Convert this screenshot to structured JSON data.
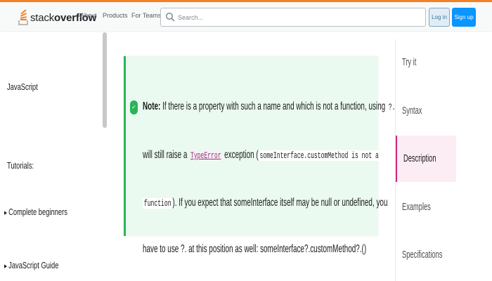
{
  "header": {
    "logo": {
      "prefix": "stack",
      "suffix": "overflow"
    },
    "nav": [
      "About",
      "Products",
      "For Teams"
    ],
    "search": {
      "placeholder": "Search...",
      "value": ""
    },
    "login_label": "Log in",
    "signup_label": "Sign up",
    "colors": {
      "accent": "#f48024",
      "primary": "#0a95ff"
    }
  },
  "sidebar": {
    "section": "JavaScript",
    "tutorials_heading": "Tutorials:",
    "links": [
      "Complete beginners",
      "JavaScript Guide"
    ]
  },
  "note": {
    "label": "Note:",
    "line1": " If there is a property with such a name and which is not a function, using ",
    "line1_code": "?.",
    "line2_prefix": "will still raise a ",
    "line2_link": "TypeError",
    "line2_mid": " exception (",
    "line2_code": "someInterface.customMethod is not a",
    "line3_code": "function",
    "line3_rest": "). If you expect that someInterface itself may be null or undefined, you",
    "after": "have to use ?. at this position as well: someInterface?.customMethod?.()",
    "colors": {
      "background": "#eafaf0",
      "border": "#2bb457"
    }
  },
  "toc": {
    "items": [
      "Try it",
      "Syntax",
      "Description",
      "Examples",
      "Specifications"
    ],
    "active_index": 2,
    "active_color": "#cc2a7a"
  }
}
